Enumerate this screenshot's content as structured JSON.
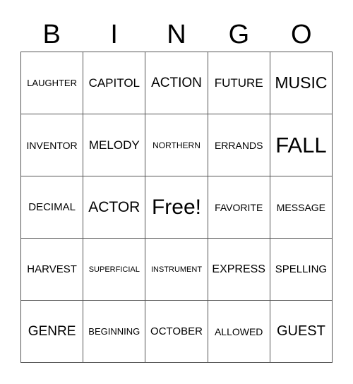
{
  "header": [
    "B",
    "I",
    "N",
    "G",
    "O"
  ],
  "cells": [
    [
      "LAUGHTER",
      "CAPITOL",
      "ACTION",
      "FUTURE",
      "MUSIC"
    ],
    [
      "INVENTOR",
      "MELODY",
      "NORTHERN",
      "ERRANDS",
      "FALL"
    ],
    [
      "DECIMAL",
      "ACTOR",
      "Free!",
      "FAVORITE",
      "MESSAGE"
    ],
    [
      "HARVEST",
      "SUPERFICIAL",
      "INSTRUMENT",
      "EXPRESS",
      "SPELLING"
    ],
    [
      "GENRE",
      "BEGINNING",
      "OCTOBER",
      "ALLOWED",
      "GUEST"
    ]
  ]
}
